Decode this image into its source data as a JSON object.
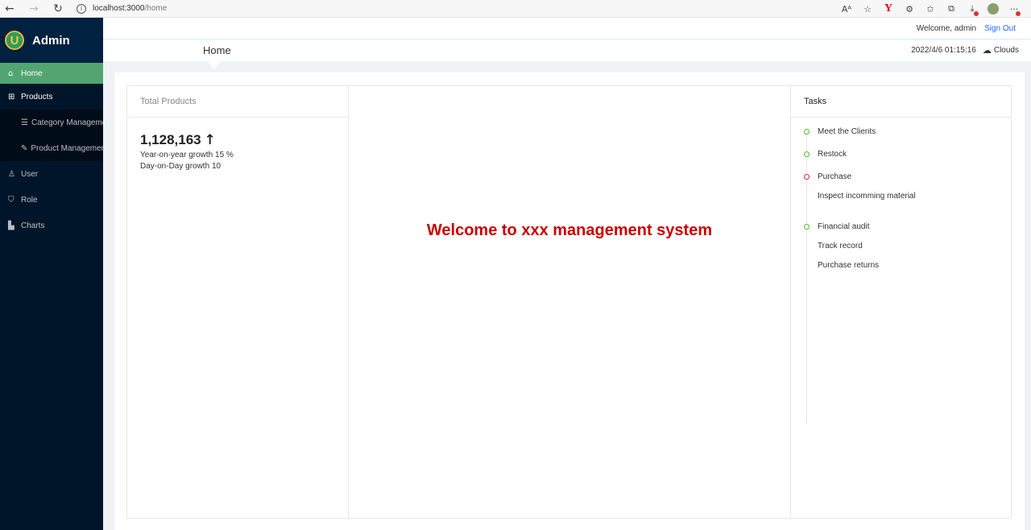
{
  "browser": {
    "url_host": "localhost:3000",
    "url_path": "/home",
    "icons": [
      "back-icon",
      "forward-icon",
      "reload-icon",
      "info-icon",
      "read-aloud-icon",
      "favorite-add-icon",
      "yandex-icon",
      "extensions-icon",
      "favorites-icon",
      "collections-icon",
      "downloads-icon",
      "profile-icon",
      "more-icon"
    ]
  },
  "sidebar": {
    "brand": "Admin",
    "logo_letter": "U",
    "items": [
      {
        "label": "Home",
        "icon": "home-icon"
      },
      {
        "label": "Products",
        "icon": "appstore-icon"
      },
      {
        "label": "Category Management",
        "icon": "bars-icon"
      },
      {
        "label": "Product Management",
        "icon": "tool-icon"
      },
      {
        "label": "User",
        "icon": "user-icon"
      },
      {
        "label": "Role",
        "icon": "safety-icon"
      },
      {
        "label": "Charts",
        "icon": "area-chart-icon"
      }
    ]
  },
  "header": {
    "welcome": "Welcome, admin",
    "sign_out": "Sign Out",
    "page_title": "Home",
    "datetime": "2022/4/6 01:15:16",
    "weather": "Clouds"
  },
  "products_card": {
    "title": "Total Products",
    "total": "1,128,163",
    "yoy_label": "Year-on-year growth",
    "yoy_value": "15 %",
    "dod_label": "Day-on-Day growth",
    "dod_value": "10"
  },
  "welcome_card": {
    "message": "Welcome to xxx management system"
  },
  "tasks_card": {
    "title": "Tasks",
    "items": [
      {
        "title": "Meet the Clients",
        "status": "green",
        "subs": []
      },
      {
        "title": "Restock",
        "status": "green",
        "subs": []
      },
      {
        "title": "Purchase",
        "status": "red",
        "subs": [
          "Inspect incomming material"
        ]
      },
      {
        "title": "Financial audit",
        "status": "green",
        "subs": [
          "Track record",
          "Purchase returns"
        ]
      }
    ]
  },
  "colors": {
    "sidebar_bg": "#001529",
    "active_item": "#52a571",
    "welcome_text": "#cc0000",
    "link": "#1e64ff"
  }
}
